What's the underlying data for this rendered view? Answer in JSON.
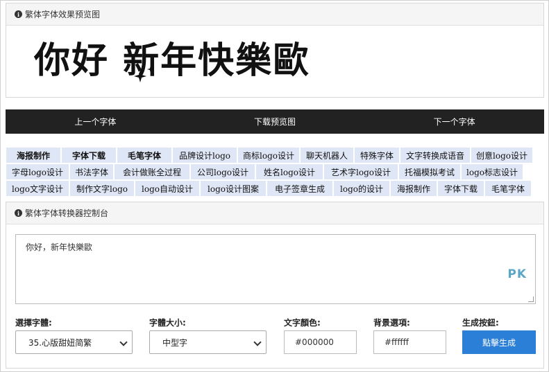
{
  "preview_panel": {
    "title": "繁体字体效果预览图",
    "preview_text": "你好  新年快樂歐"
  },
  "navbar": {
    "prev_label": "上一个字体",
    "download_label": "下载预览图",
    "next_label": "下一个字体"
  },
  "tag_rows": [
    [
      {
        "label": "海报制作",
        "bold": true,
        "w": 78
      },
      {
        "label": "字体下载",
        "bold": true,
        "w": 78
      },
      {
        "label": "毛笔字体",
        "bold": true,
        "w": 78
      },
      {
        "label": "品牌设计logo",
        "bold": false,
        "w": 92
      },
      {
        "label": "商标logo设计",
        "bold": false,
        "w": 88
      },
      {
        "label": "聊天机器人",
        "bold": false,
        "w": 76
      },
      {
        "label": "特殊字体",
        "bold": false,
        "w": 64
      },
      {
        "label": "文字转换成语音",
        "bold": false,
        "w": 100
      },
      {
        "label": "创意logo设计",
        "bold": false,
        "w": 88
      }
    ],
    [
      {
        "label": "字母logo设计",
        "bold": false,
        "w": 90
      },
      {
        "label": "书法字体",
        "bold": false,
        "w": 62
      },
      {
        "label": "会计做账全过程",
        "bold": false,
        "w": 108
      },
      {
        "label": "公司logo设计",
        "bold": false,
        "w": 92
      },
      {
        "label": "姓名logo设计",
        "bold": false,
        "w": 96
      },
      {
        "label": "艺术字logo设计",
        "bold": false,
        "w": 106
      },
      {
        "label": "托福模拟考试",
        "bold": false,
        "w": 88
      },
      {
        "label": "logo标志设计",
        "bold": false,
        "w": 88
      }
    ],
    [
      {
        "label": "logo文字设计",
        "bold": false,
        "w": 90
      },
      {
        "label": "制作文字logo",
        "bold": false,
        "w": 92
      },
      {
        "label": "logo自动设计",
        "bold": false,
        "w": 92
      },
      {
        "label": "logo设计图案",
        "bold": false,
        "w": 94
      },
      {
        "label": "电子签章生成",
        "bold": false,
        "w": 94
      },
      {
        "label": "logo的设计",
        "bold": false,
        "w": 80
      },
      {
        "label": "海报制作",
        "bold": false,
        "w": 66
      },
      {
        "label": "字体下载",
        "bold": false,
        "w": 66
      },
      {
        "label": "毛笔字体",
        "bold": false,
        "w": 66
      }
    ]
  ],
  "console_panel": {
    "title": "繁体字体转换器控制台",
    "textarea_value": "你好，新年快樂歐",
    "watermark_text": "PK",
    "font_label": "選擇字體:",
    "font_value": "35.心版甜妞简繁",
    "size_label": "字體大小:",
    "size_value": "中型字",
    "color_label": "文字顏色:",
    "color_value": "#000000",
    "bg_label": "背景選項:",
    "bg_value": "#ffffff",
    "generate_label": "生成按鈕:",
    "generate_button": "點擊生成"
  },
  "colors": {
    "navbar_bg": "#222222",
    "tag_bg": "#dfe6f5",
    "button_bg": "#2c7fd6"
  }
}
